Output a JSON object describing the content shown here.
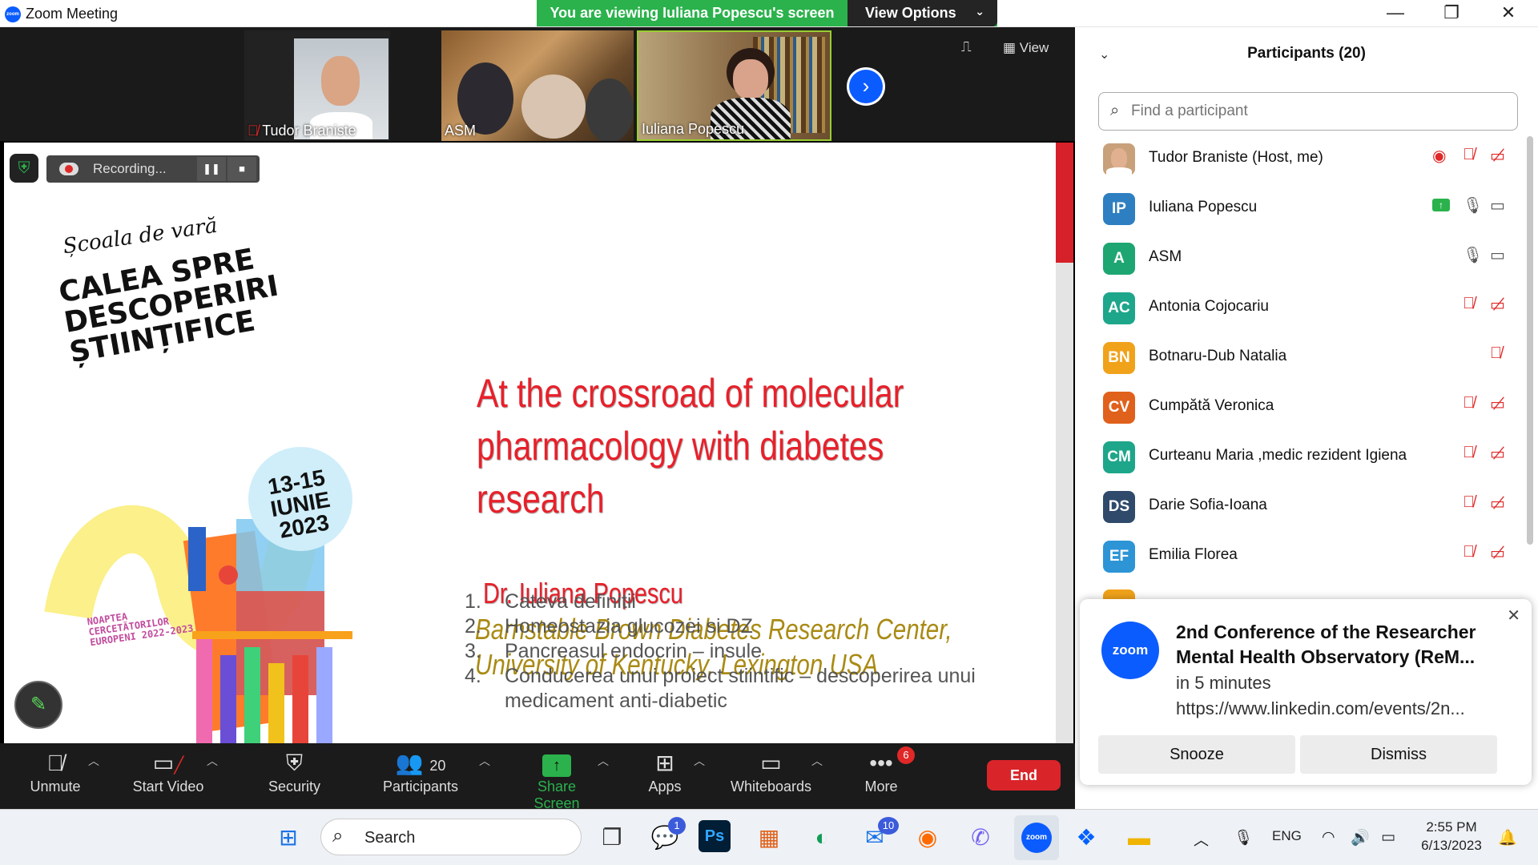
{
  "window": {
    "title": "Zoom Meeting",
    "logo": "zoom"
  },
  "banner": {
    "message": "You are viewing Iuliana Popescu's screen",
    "view_options": "View Options"
  },
  "strip": {
    "tiles": [
      {
        "name": "Tudor Braniste"
      },
      {
        "name": "ASM"
      },
      {
        "name": "Iuliana Popescu"
      }
    ],
    "view_label": "View"
  },
  "recording": {
    "label": "Recording..."
  },
  "slide": {
    "poster_line1": "Școala de vară",
    "poster_line2": "CALEA SPRE DESCOPERIRI ȘTIINȚIFICE",
    "poster_date": "13-15 IUNIE 2023",
    "poster_footer": "NOAPTEA CERCETĂTORILOR EUROPENI 2022-2023",
    "title_lines": [
      "At the crossroad of molecular",
      "pharmacology with diabetes",
      "research"
    ],
    "author": "Dr. Iuliana Popescu",
    "affiliation_lines": [
      "Barnstable Brown Diabetes Research Center,",
      "University of Kentucky, Lexington USA"
    ],
    "outline": [
      {
        "num": "1.",
        "text": "Cateva definitii"
      },
      {
        "num": "2.",
        "text": "Homeostazia glucozei si DZ"
      },
      {
        "num": "3.",
        "text": "Pancreasul endocrin – insule"
      },
      {
        "num": "4.",
        "text": "Conducerea unui proiect stiintific – descoperirea unui medicament anti-diabetic"
      }
    ]
  },
  "toolbar": {
    "unmute": "Unmute",
    "start_video": "Start Video",
    "security": "Security",
    "participants": "Participants",
    "participants_count": "20",
    "share_screen": "Share Screen",
    "apps": "Apps",
    "whiteboards": "Whiteboards",
    "more": "More",
    "more_badge": "6",
    "end": "End"
  },
  "panel": {
    "title": "Participants (20)",
    "search_placeholder": "Find a participant",
    "participants": [
      {
        "initials": "",
        "name": "Tudor Braniste (Host, me)",
        "color": "#c8a07a",
        "mic": "muted",
        "video": "off",
        "recording": true
      },
      {
        "initials": "IP",
        "name": "Iuliana Popescu",
        "color": "#2d7fc1",
        "mic": "on",
        "video": "on",
        "sharing": true
      },
      {
        "initials": "A",
        "name": "ASM",
        "color": "#1ea672",
        "mic": "on",
        "video": "on"
      },
      {
        "initials": "AC",
        "name": "Antonia Cojocariu",
        "color": "#1ea68a",
        "mic": "muted",
        "video": "off"
      },
      {
        "initials": "BN",
        "name": "Botnaru-Dub Natalia",
        "color": "#f0a21b",
        "mic": "muted",
        "video": "none"
      },
      {
        "initials": "CV",
        "name": "Cumpătă Veronica",
        "color": "#e0611b",
        "mic": "muted",
        "video": "off"
      },
      {
        "initials": "CM",
        "name": "Curteanu Maria ,medic rezident Igiena",
        "color": "#1ea68a",
        "mic": "muted",
        "video": "off"
      },
      {
        "initials": "DS",
        "name": "Darie Sofia-Ioana",
        "color": "#2f4a6b",
        "mic": "muted",
        "video": "off"
      },
      {
        "initials": "EF",
        "name": "Emilia Florea",
        "color": "#2d95d6",
        "mic": "muted",
        "video": "off"
      }
    ]
  },
  "notification": {
    "logo": "zoom",
    "title": "2nd Conference of the Researcher Mental Health Observatory (ReM...",
    "time": "in 5 minutes",
    "url": "https://www.linkedin.com/events/2n...",
    "snooze": "Snooze",
    "dismiss": "Dismiss"
  },
  "taskbar": {
    "search": "Search",
    "teams_badge": "1",
    "mail_badge": "10",
    "ps_label": "Ps",
    "zoom_label": "zoom",
    "lang": "ENG",
    "time": "2:55 PM",
    "date": "6/13/2023"
  }
}
